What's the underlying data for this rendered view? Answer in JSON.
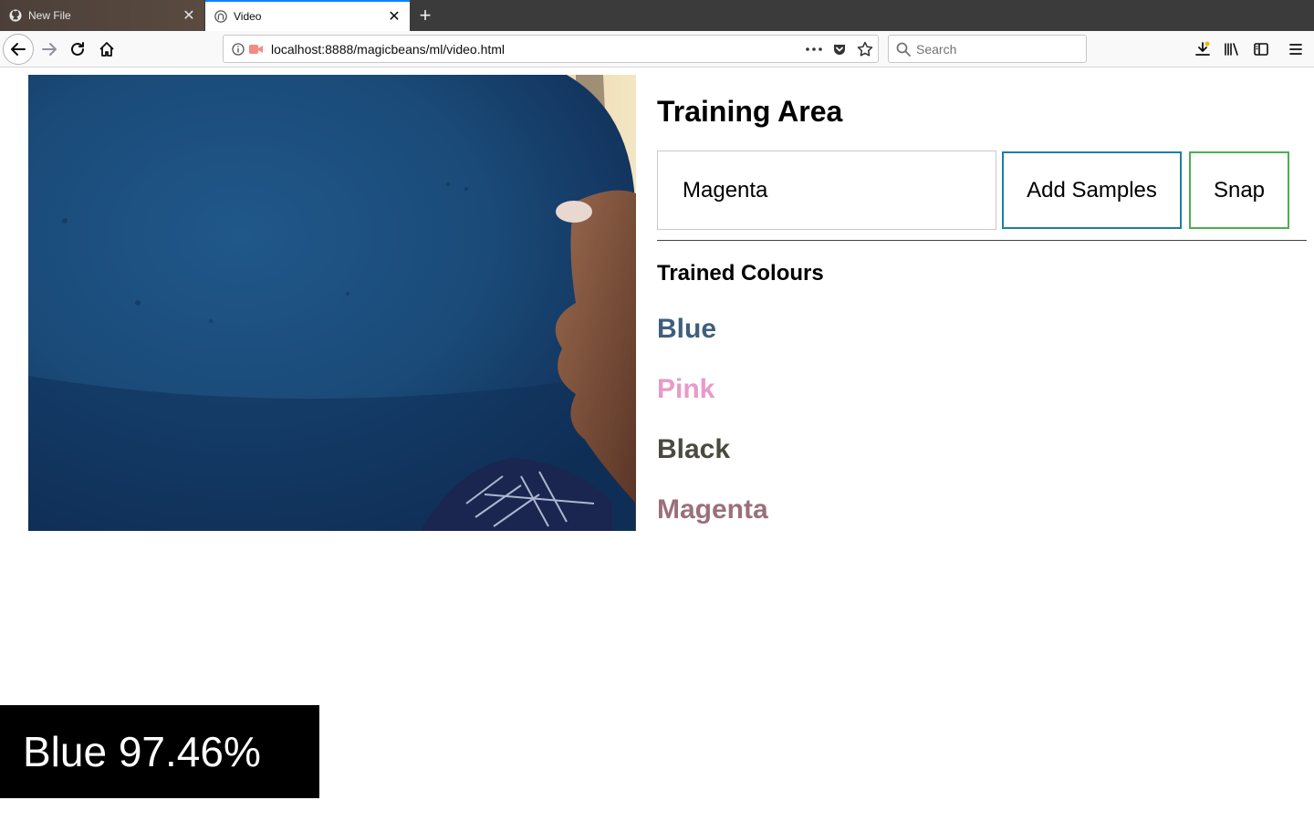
{
  "browser": {
    "tabs": [
      {
        "title": "New File",
        "favicon": "github-icon",
        "active": false
      },
      {
        "title": "Video",
        "favicon": "globe-icon",
        "active": true
      }
    ],
    "url": "localhost:8888/magicbeans/ml/video.html",
    "search_placeholder": "Search"
  },
  "page": {
    "title": "Training Area",
    "label_input_value": "Magenta",
    "add_samples_label": "Add Samples",
    "snap_label": "Snap",
    "trained_title": "Trained Colours",
    "trained_colours": [
      {
        "name": "Blue",
        "color": "#3f5f7c"
      },
      {
        "name": "Pink",
        "color": "#e89ac8"
      },
      {
        "name": "Black",
        "color": "#4a4a40"
      },
      {
        "name": "Magenta",
        "color": "#9a707a"
      }
    ],
    "prediction": "Blue 97.46%"
  },
  "colors": {
    "accent_tab": "#0a84ff",
    "add_button_border": "#1a7fa8",
    "snap_button_border": "#4caf50"
  }
}
